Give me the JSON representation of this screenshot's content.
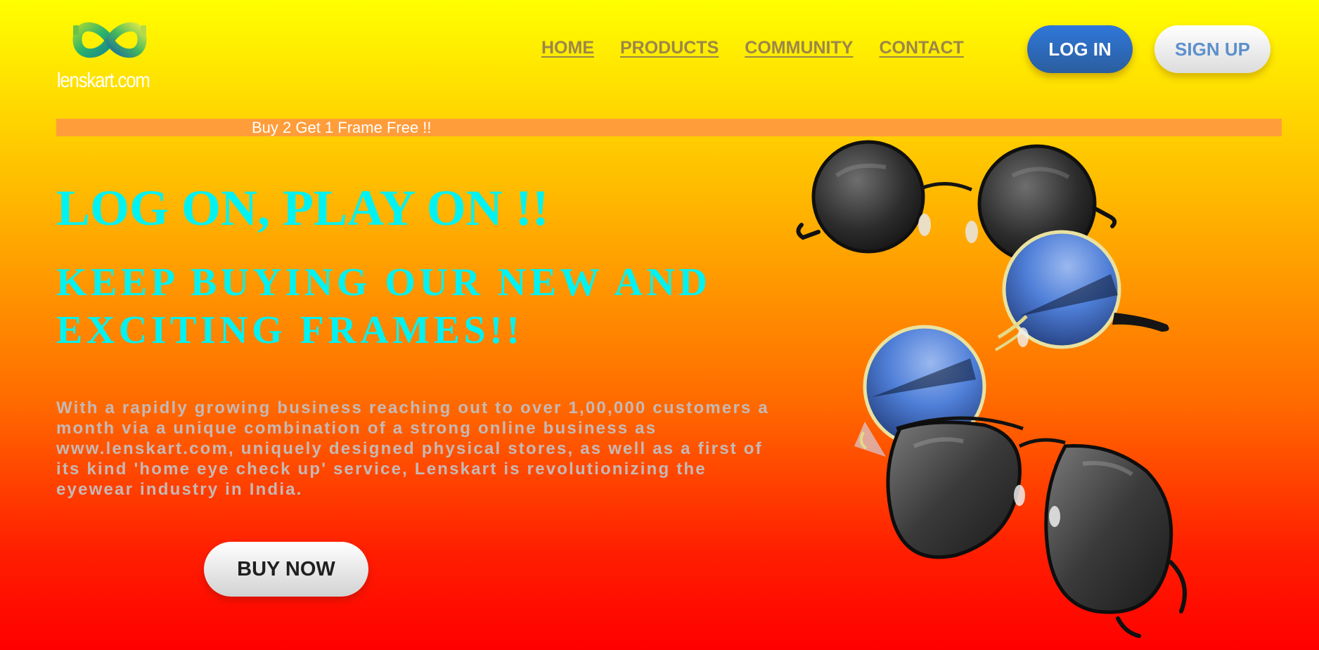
{
  "brand": {
    "name": "lenskart.com"
  },
  "nav": {
    "items": [
      {
        "label": "HOME"
      },
      {
        "label": "PRODUCTS"
      },
      {
        "label": "COMMUNITY"
      },
      {
        "label": "CONTACT"
      }
    ]
  },
  "auth": {
    "login_label": "LOG IN",
    "signup_label": "SIGN UP"
  },
  "promo": {
    "text": "Buy 2 Get 1 Frame Free !!"
  },
  "hero": {
    "headline": "LOG ON, PLAY ON !!",
    "subheadline": "KEEP BUYING OUR NEW AND EXCITING FRAMES!!",
    "description": "With a rapidly growing business reaching out to over 1,00,000 customers a month via a unique combination of a strong online business as www.lenskart.com, uniquely designed physical stores, as well as a first of its kind 'home eye check up' service, Lenskart is revolutionizing the eyewear industry in India.",
    "cta_label": "BUY NOW"
  },
  "product_image": {
    "icon": "sunglasses-stack-image"
  },
  "colors": {
    "gradient_top": "#ffff00",
    "gradient_bottom": "#ff0000",
    "headline": "#00f2f2",
    "nav_link": "#9b8748",
    "login_button": "#2f77d9",
    "signup_text": "#5d90cc",
    "promo_bar": "#ff9d3a",
    "description_text": "#c4b9b6"
  }
}
